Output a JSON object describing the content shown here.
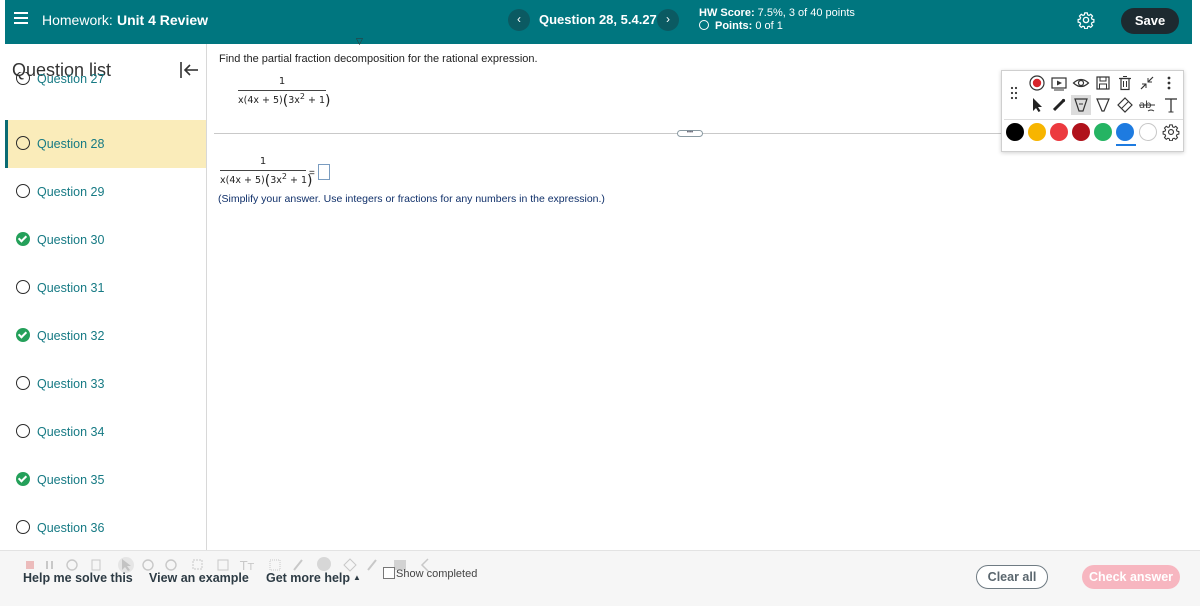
{
  "header": {
    "homework_prefix": "Homework:",
    "homework_name": "Unit 4 Review",
    "prev_label": "‹",
    "next_label": "›",
    "question_title": "Question 28, 5.4.27",
    "hw_score_label": "HW Score:",
    "hw_score_value": " 7.5%, 3 of 40 points",
    "points_label": "Points:",
    "points_value": " 0 of 1",
    "save_label": "Save",
    "accent_color": "#00767f"
  },
  "sidebar": {
    "title": "Question list",
    "items": [
      {
        "label": "Question 27",
        "status": "open"
      },
      {
        "label": "Question 28",
        "status": "open",
        "active": true
      },
      {
        "label": "Question 29",
        "status": "open"
      },
      {
        "label": "Question 30",
        "status": "completed"
      },
      {
        "label": "Question 31",
        "status": "open"
      },
      {
        "label": "Question 32",
        "status": "completed"
      },
      {
        "label": "Question 33",
        "status": "open"
      },
      {
        "label": "Question 34",
        "status": "open"
      },
      {
        "label": "Question 35",
        "status": "completed"
      },
      {
        "label": "Question 36",
        "status": "open"
      }
    ]
  },
  "question": {
    "prompt": "Find the partial fraction decomposition for the rational expression.",
    "expression": {
      "numerator": "1",
      "den_a": "x(4x + 5)",
      "den_b": "3x",
      "den_exp": "2",
      "den_c": " + 1"
    },
    "equals": "=",
    "hint": "(Simplify your answer. Use integers or fractions for any numbers in the expression.)",
    "answer_value": ""
  },
  "annotation_toolbar": {
    "tools_row1": [
      "record-icon",
      "play-video-icon",
      "eye-icon",
      "save-icon",
      "trash-icon",
      "collapse-arrows-icon",
      "more-vertical-icon"
    ],
    "tools_row2": [
      "pointer-icon",
      "marker-icon",
      "highlighter-icon",
      "pen-icon",
      "eraser-icon",
      "strikethrough-text-icon",
      "text-icon"
    ],
    "colors": [
      "#000000",
      "#f7b500",
      "#ec3a3f",
      "#b0121b",
      "#25b463",
      "#1e7be0",
      "#ffffff"
    ],
    "selected_color": "#1e7be0"
  },
  "footer": {
    "help_solve": "Help me solve this",
    "view_example": "View an example",
    "more_help": "Get more help",
    "more_help_caret": "▲",
    "show_completed": "Show completed",
    "clear_all": "Clear all",
    "check_answer": "Check answer"
  }
}
